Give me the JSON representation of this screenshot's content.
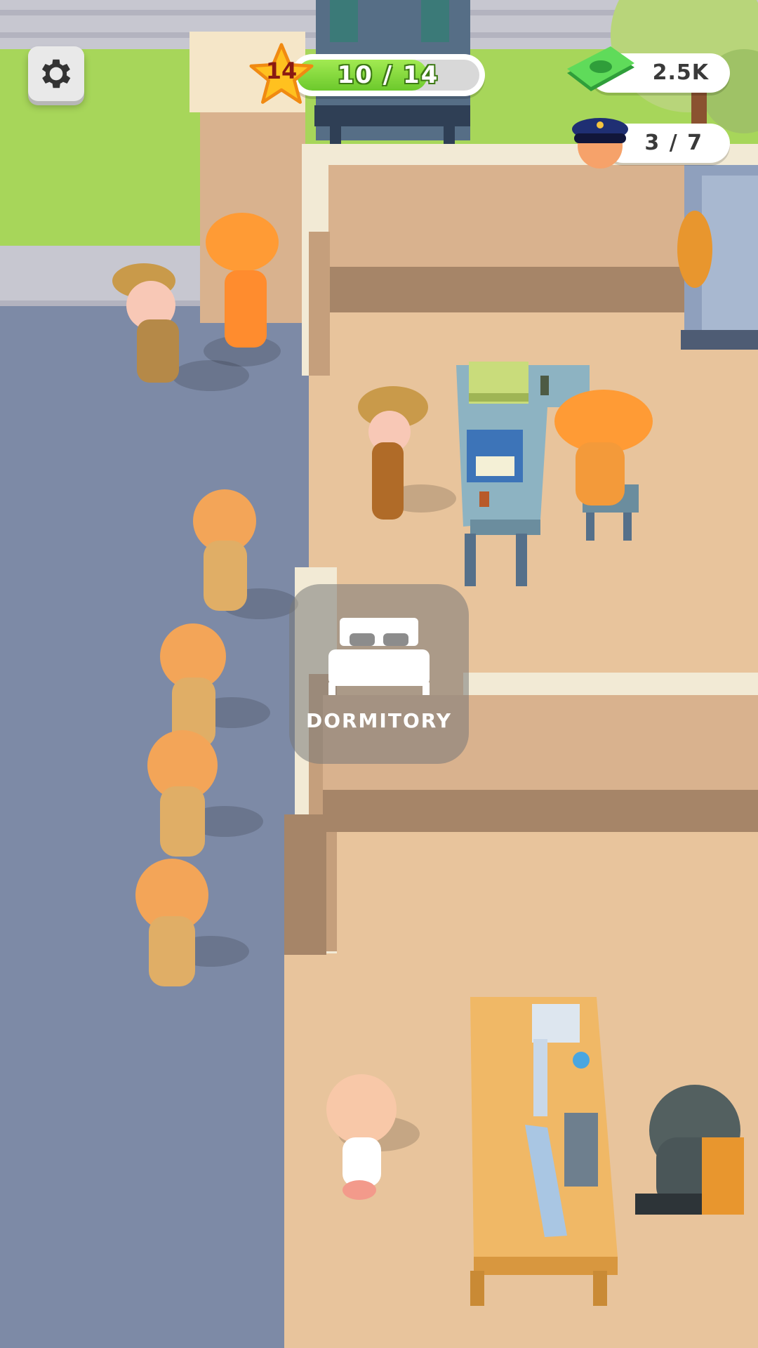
{
  "hud": {
    "level": "14",
    "progress_text": "10 / 14",
    "progress_fraction": 0.7142857,
    "money": "2.5K",
    "staff_count": "3 / 7"
  },
  "zones": {
    "dormitory_label": "DORMITORY"
  },
  "colors": {
    "ground": "#7d8aa6",
    "floor": "#e8c49c",
    "grass": "#a7d65a",
    "wall": "#d7b38e",
    "progress_fill": "#7dd33a",
    "star": "#ffc11f"
  },
  "icons": [
    "gear-icon",
    "star-icon",
    "cash-icon",
    "guard-cap-icon",
    "bed-icon"
  ]
}
